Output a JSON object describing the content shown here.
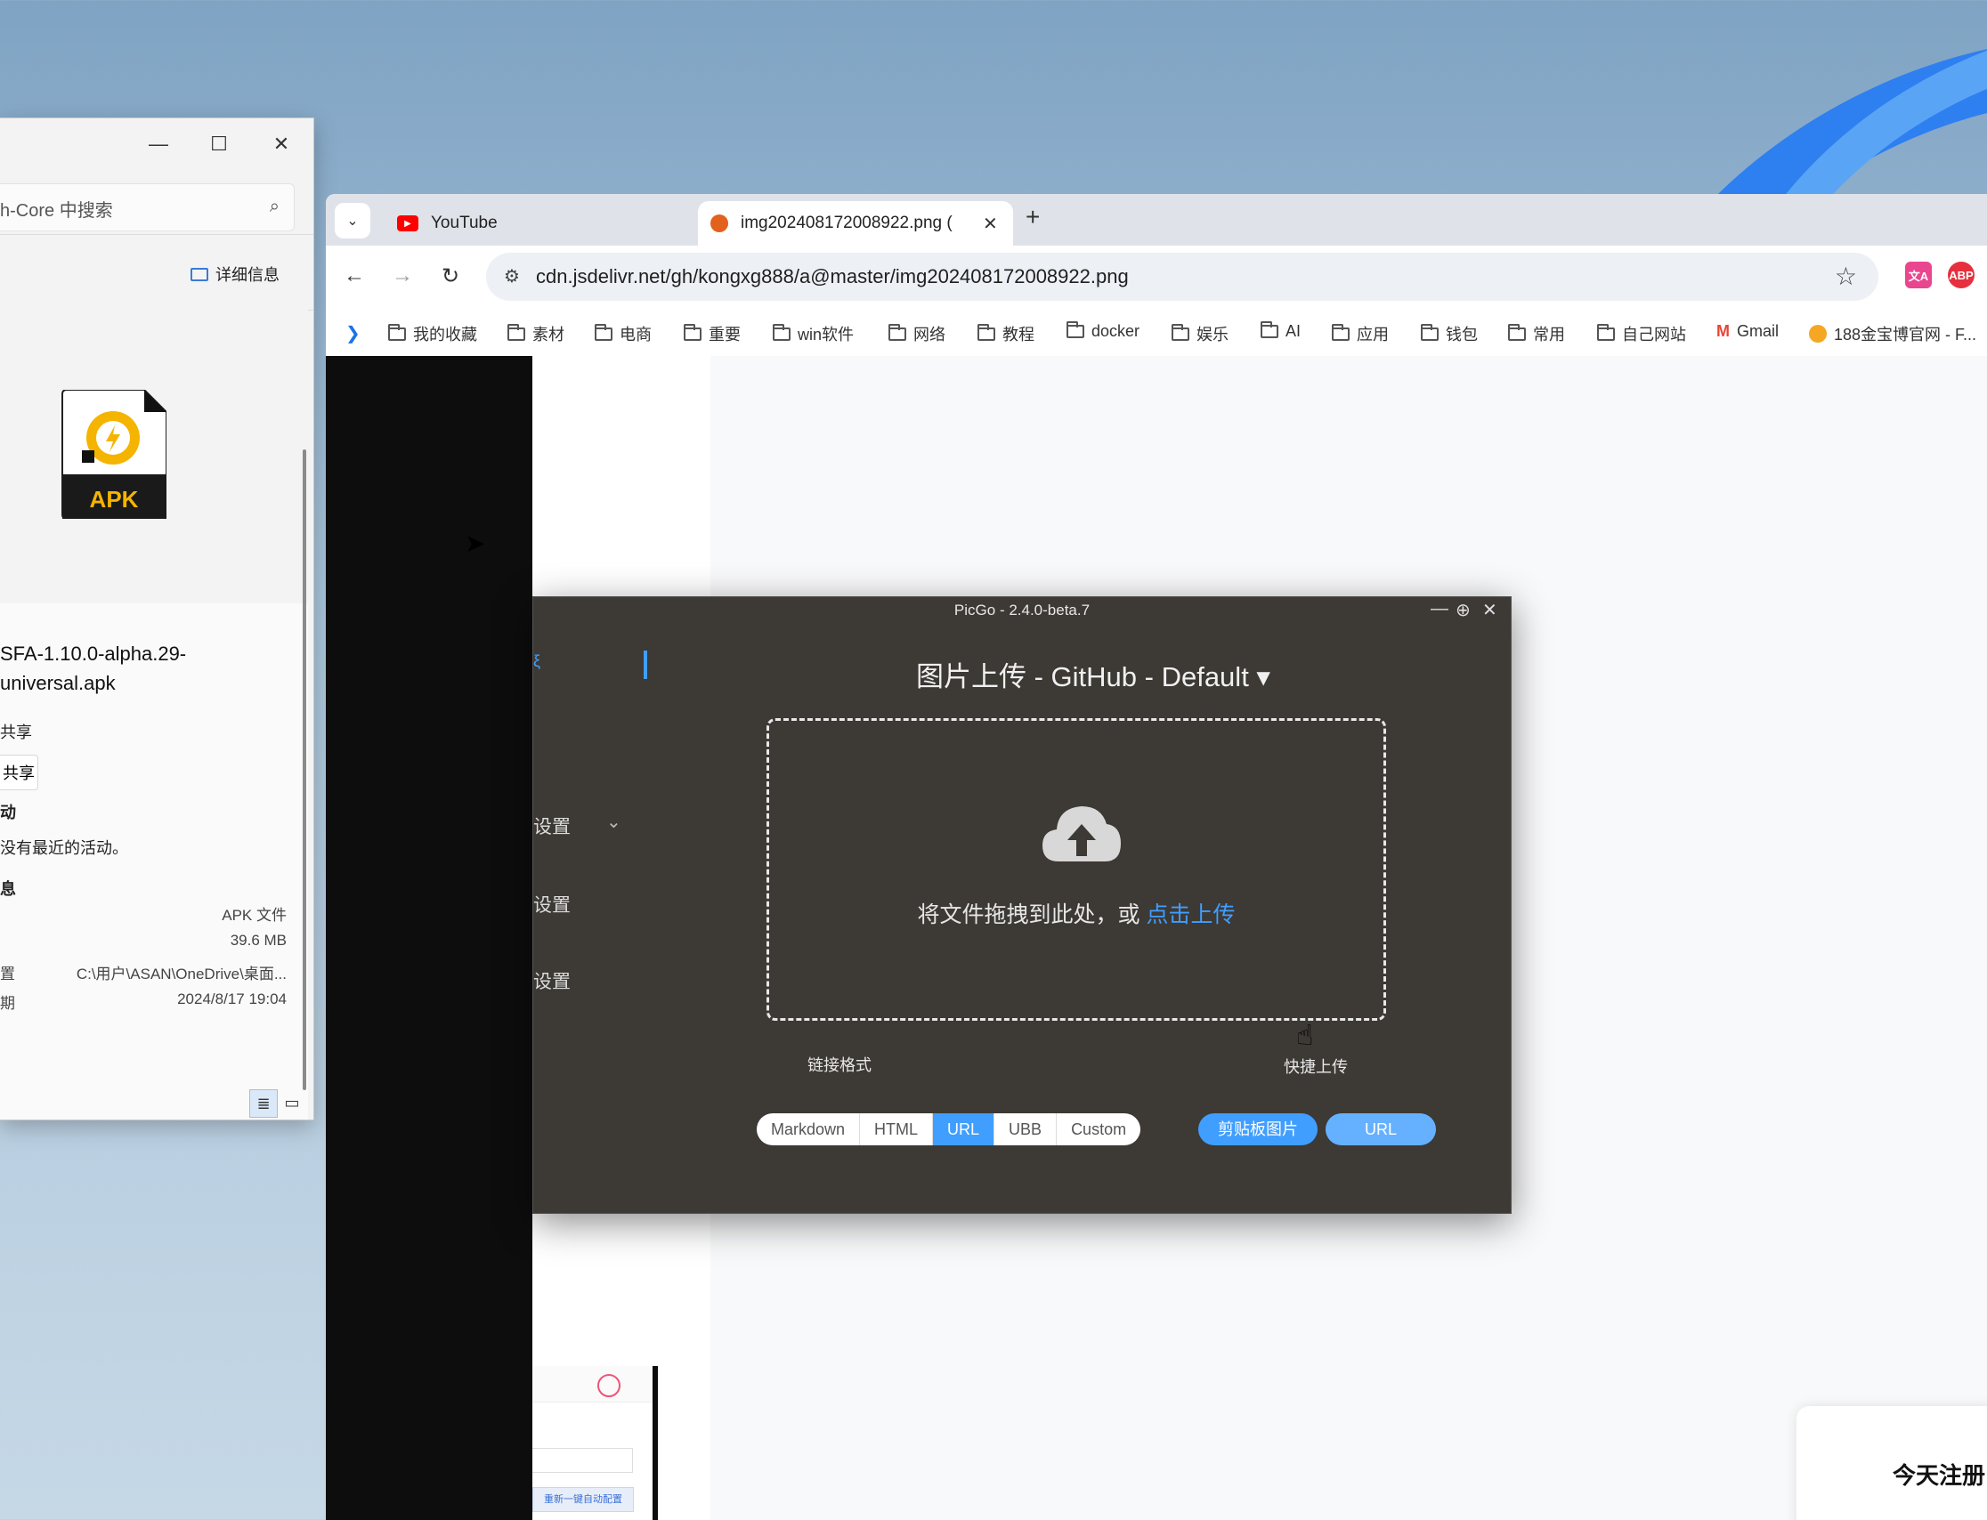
{
  "explorer": {
    "search_placeholder": "h-Core 中搜索",
    "details_label": "详细信息",
    "apk_badge": "APK",
    "file_name_line1": "SFA-1.10.0-alpha.29-",
    "file_name_line2": "universal.apk",
    "share_label": "共享",
    "share_button": "共享",
    "activity_heading": "动",
    "activity_text": "没有最近的活动。",
    "info_heading": "息",
    "props": [
      {
        "key": "",
        "value": "APK 文件"
      },
      {
        "key": "",
        "value": "39.6 MB"
      },
      {
        "key": "置",
        "value": "C:\\用户\\ASAN\\OneDrive\\桌面..."
      },
      {
        "key": "期",
        "value": "2024/8/17 19:04"
      }
    ]
  },
  "browser": {
    "tabs": [
      {
        "label": "YouTube",
        "favicon": "youtube-icon"
      },
      {
        "label": "img202408172008922.png (",
        "favicon": "jsdelivr-icon"
      }
    ],
    "url": "cdn.jsdelivr.net/gh/kongxg888/a@master/img202408172008922.png",
    "extensions": [
      {
        "label": "文A",
        "color": "#e9468f"
      },
      {
        "label": "ABP",
        "color": "#e6303d"
      }
    ],
    "bookmarks": [
      "我的收藏",
      "素材",
      "电商",
      "重要",
      "win软件",
      "网络",
      "教程",
      "docker",
      "娱乐",
      "AI",
      "应用",
      "钱包",
      "常用",
      "自己网站",
      "Gmail",
      "188金宝博官网 - F..."
    ],
    "right_card_text": "今天注册"
  },
  "picgo": {
    "title": "PicGo - 2.4.0-beta.7",
    "side_items": [
      "设置",
      "设置",
      "设置"
    ],
    "side_top": "ξ",
    "heading": "图片上传 - GitHub - Default ▾",
    "drop_text": "将文件拖拽到此处，或 ",
    "drop_link": "点击上传",
    "link_format_label": "链接格式",
    "formats": [
      "Markdown",
      "HTML",
      "URL",
      "UBB",
      "Custom"
    ],
    "active_format": "URL",
    "quick_upload_label": "快捷上传",
    "quick_buttons": [
      "剪贴板图片",
      "URL"
    ],
    "accent": "#409eff"
  },
  "mini": {
    "button_text": "重新一键自动配置"
  }
}
